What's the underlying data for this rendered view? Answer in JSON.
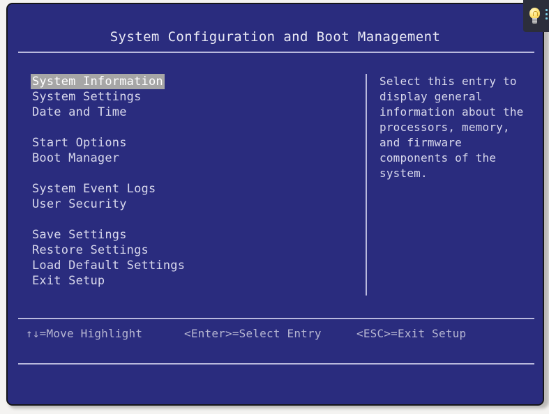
{
  "screen": {
    "title": "System Configuration and Boot Management",
    "background_color": "#2a2c7e",
    "text_color": "#d8d8ec",
    "highlight_bg_color": "#a6a6a6",
    "rule_color": "#b9b9dd"
  },
  "menu": {
    "items": [
      {
        "label": "System Information",
        "selected": true
      },
      {
        "label": "System Settings",
        "selected": false
      },
      {
        "label": "Date and Time",
        "selected": false
      },
      {
        "label": "",
        "selected": false
      },
      {
        "label": "Start Options",
        "selected": false
      },
      {
        "label": "Boot Manager",
        "selected": false
      },
      {
        "label": "",
        "selected": false
      },
      {
        "label": "System Event Logs",
        "selected": false
      },
      {
        "label": "User Security",
        "selected": false
      },
      {
        "label": "",
        "selected": false
      },
      {
        "label": "Save Settings",
        "selected": false
      },
      {
        "label": "Restore Settings",
        "selected": false
      },
      {
        "label": "Load Default Settings",
        "selected": false
      },
      {
        "label": "Exit Setup",
        "selected": false
      }
    ]
  },
  "help": {
    "lines": [
      "Select this entry to",
      "display general",
      "information about the",
      "processors, memory,",
      "and firmware",
      "components of the",
      "system."
    ]
  },
  "hints": {
    "move": "↑↓=Move Highlight",
    "enter": "<Enter>=Select Entry",
    "esc": "<ESC>=Exit Setup"
  },
  "hint_widget": {
    "icon": "lightbulb-icon",
    "background_color": "#2c2e3b"
  }
}
